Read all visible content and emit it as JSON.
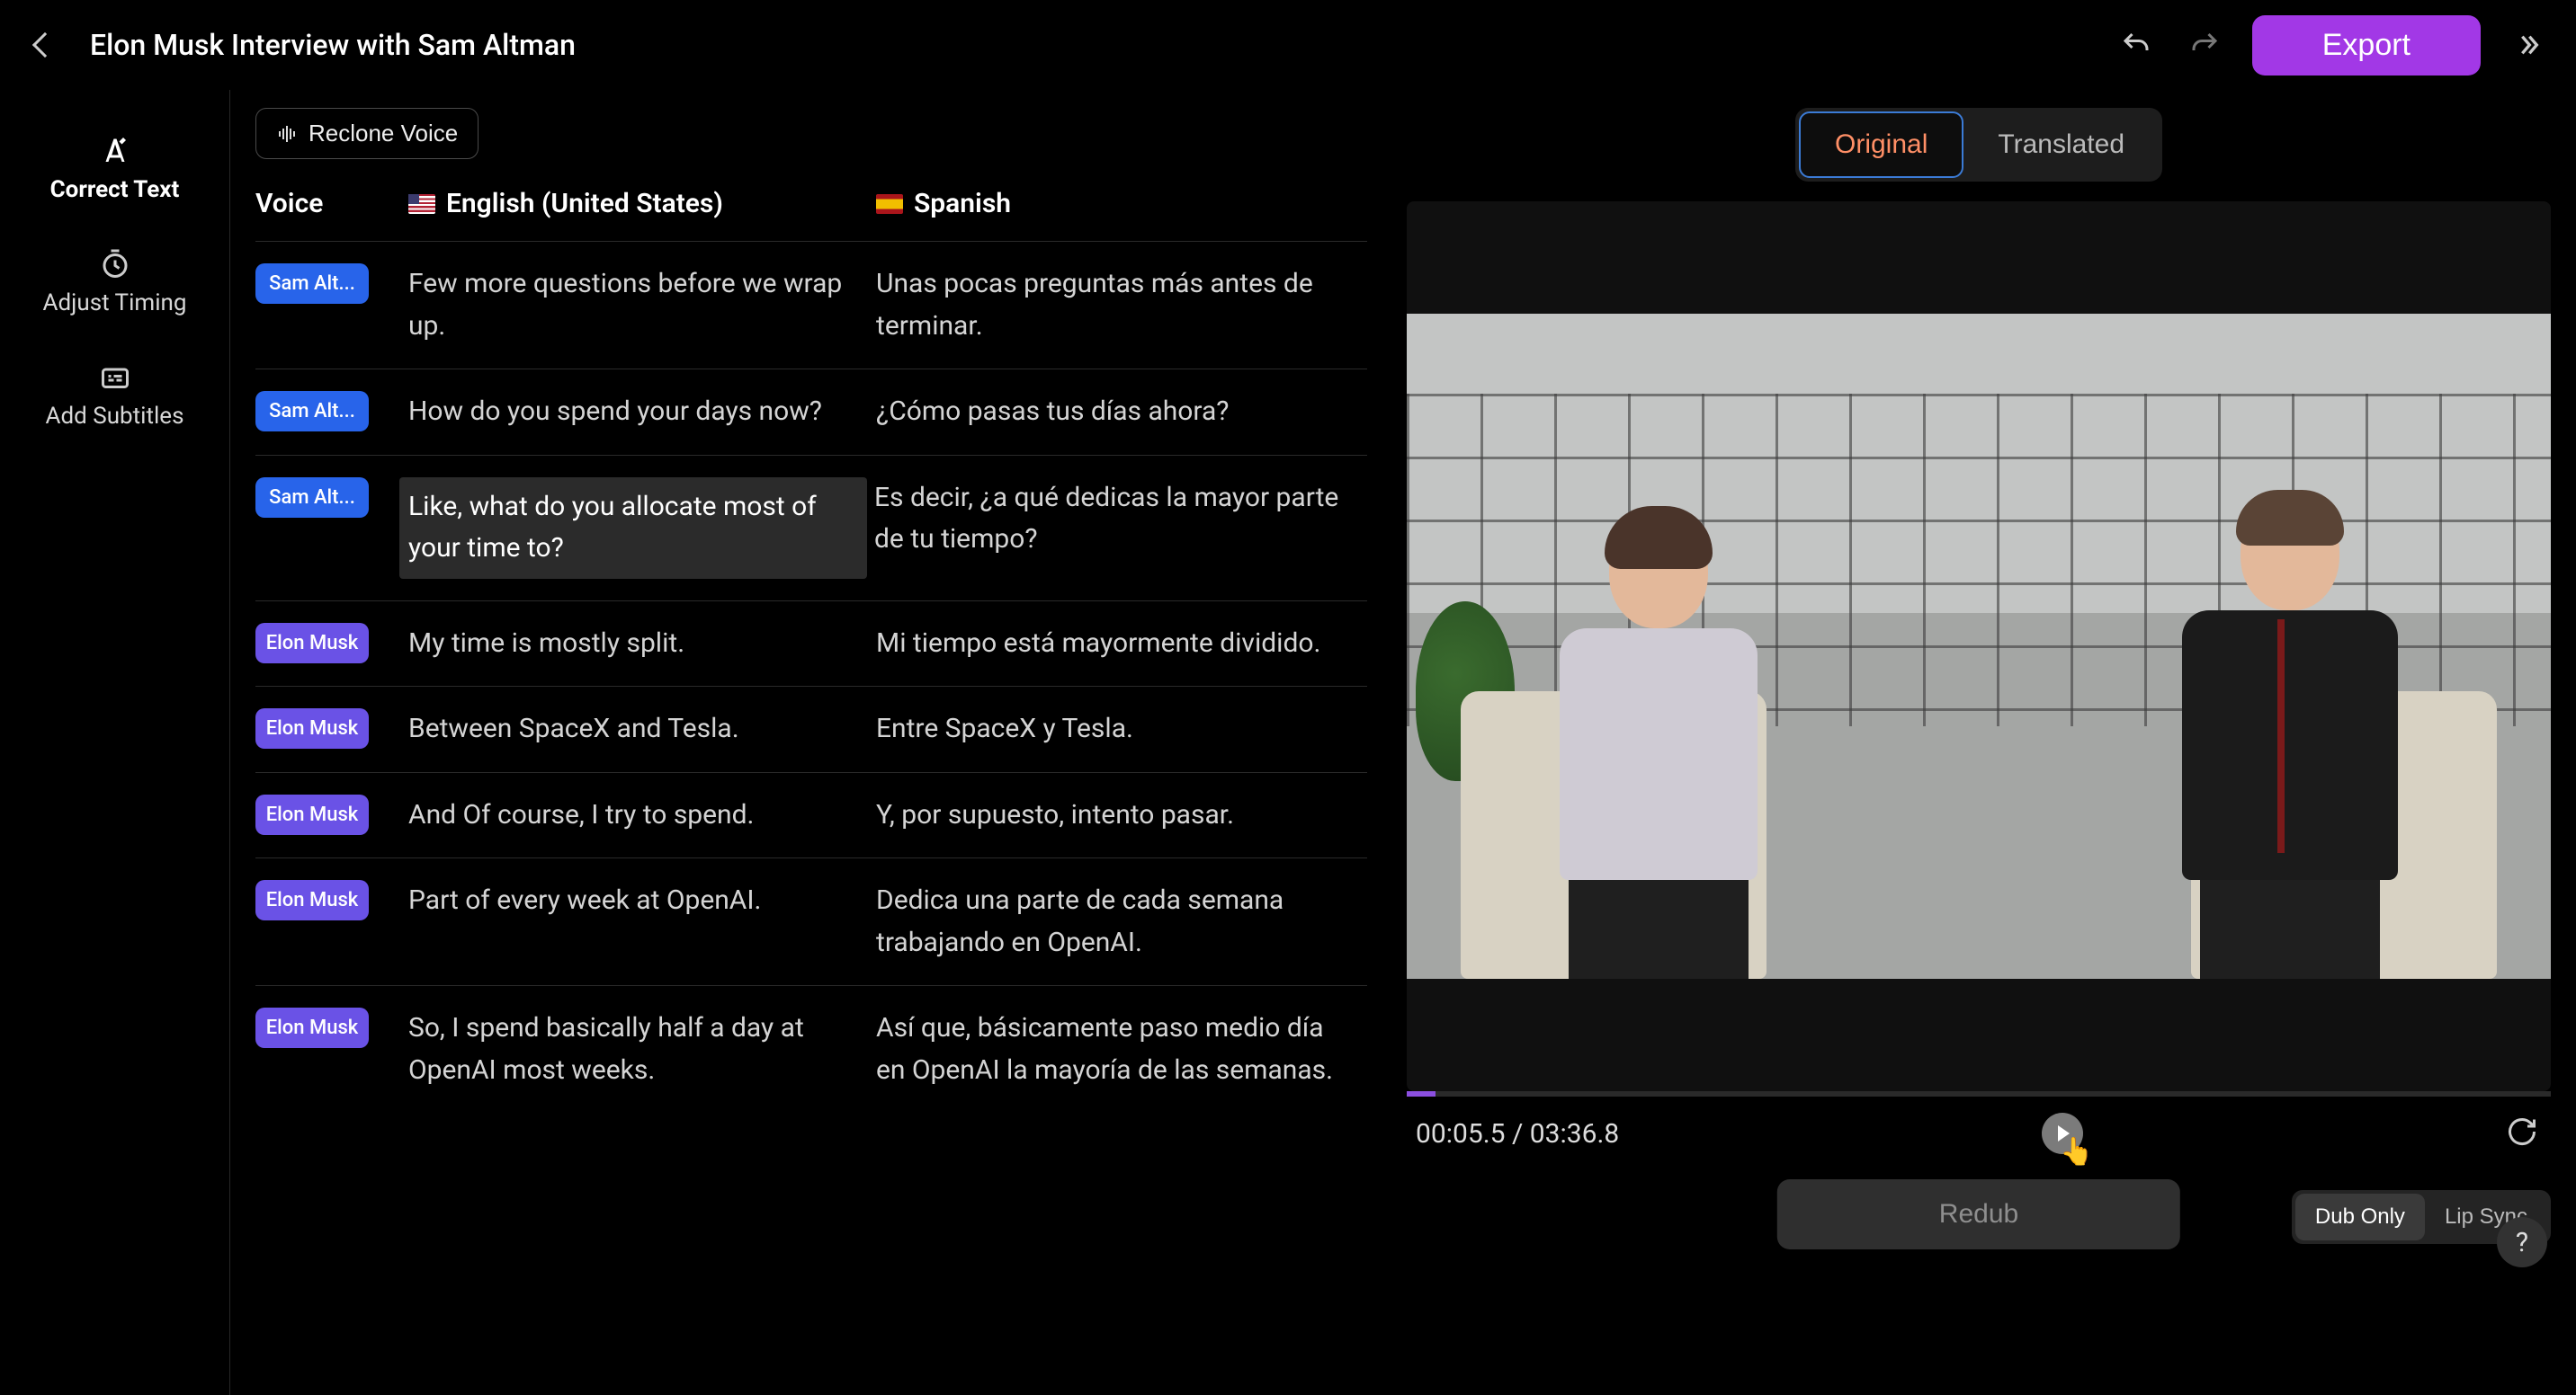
{
  "header": {
    "title": "Elon Musk Interview with Sam Altman",
    "export_label": "Export"
  },
  "sidebar": {
    "items": [
      {
        "label": "Correct Text"
      },
      {
        "label": "Adjust Timing"
      },
      {
        "label": "Add Subtitles"
      }
    ]
  },
  "reclone_label": "Reclone Voice",
  "columns": {
    "voice": "Voice",
    "source_lang": "English (United States)",
    "target_lang": "Spanish"
  },
  "speakers": {
    "sam": "Sam Alt...",
    "elon": "Elon Musk"
  },
  "transcript": [
    {
      "speaker": "sam",
      "src": "Few more questions before we wrap up.",
      "tgt": "Unas pocas preguntas más antes de terminar."
    },
    {
      "speaker": "sam",
      "src": "How do you spend your days now?",
      "tgt": "¿Cómo pasas tus días ahora?"
    },
    {
      "speaker": "sam",
      "src": "Like, what do you allocate most of your time to?",
      "tgt": "Es decir, ¿a qué dedicas la mayor parte de tu tiempo?",
      "selected": true
    },
    {
      "speaker": "elon",
      "src": "My time is mostly split.",
      "tgt": "Mi tiempo está mayormente dividido."
    },
    {
      "speaker": "elon",
      "src": "Between SpaceX and Tesla.",
      "tgt": "Entre SpaceX y Tesla."
    },
    {
      "speaker": "elon",
      "src": "And Of course, I try to spend.",
      "tgt": "Y, por supuesto, intento pasar."
    },
    {
      "speaker": "elon",
      "src": "Part of every week at OpenAI.",
      "tgt": "Dedica una parte de cada semana trabajando en OpenAI."
    },
    {
      "speaker": "elon",
      "src": "So, I spend basically half a day at OpenAI most weeks.",
      "tgt": "Así que, básicamente paso medio día en OpenAI la mayoría de las semanas."
    }
  ],
  "tabs": {
    "original": "Original",
    "translated": "Translated"
  },
  "player": {
    "current": "00:05.5",
    "duration": "03:36.8",
    "progress_percent": 2.5
  },
  "modes": {
    "dub_only": "Dub Only",
    "lip_sync": "Lip Sync"
  },
  "redub_label": "Redub",
  "help_label": "?"
}
